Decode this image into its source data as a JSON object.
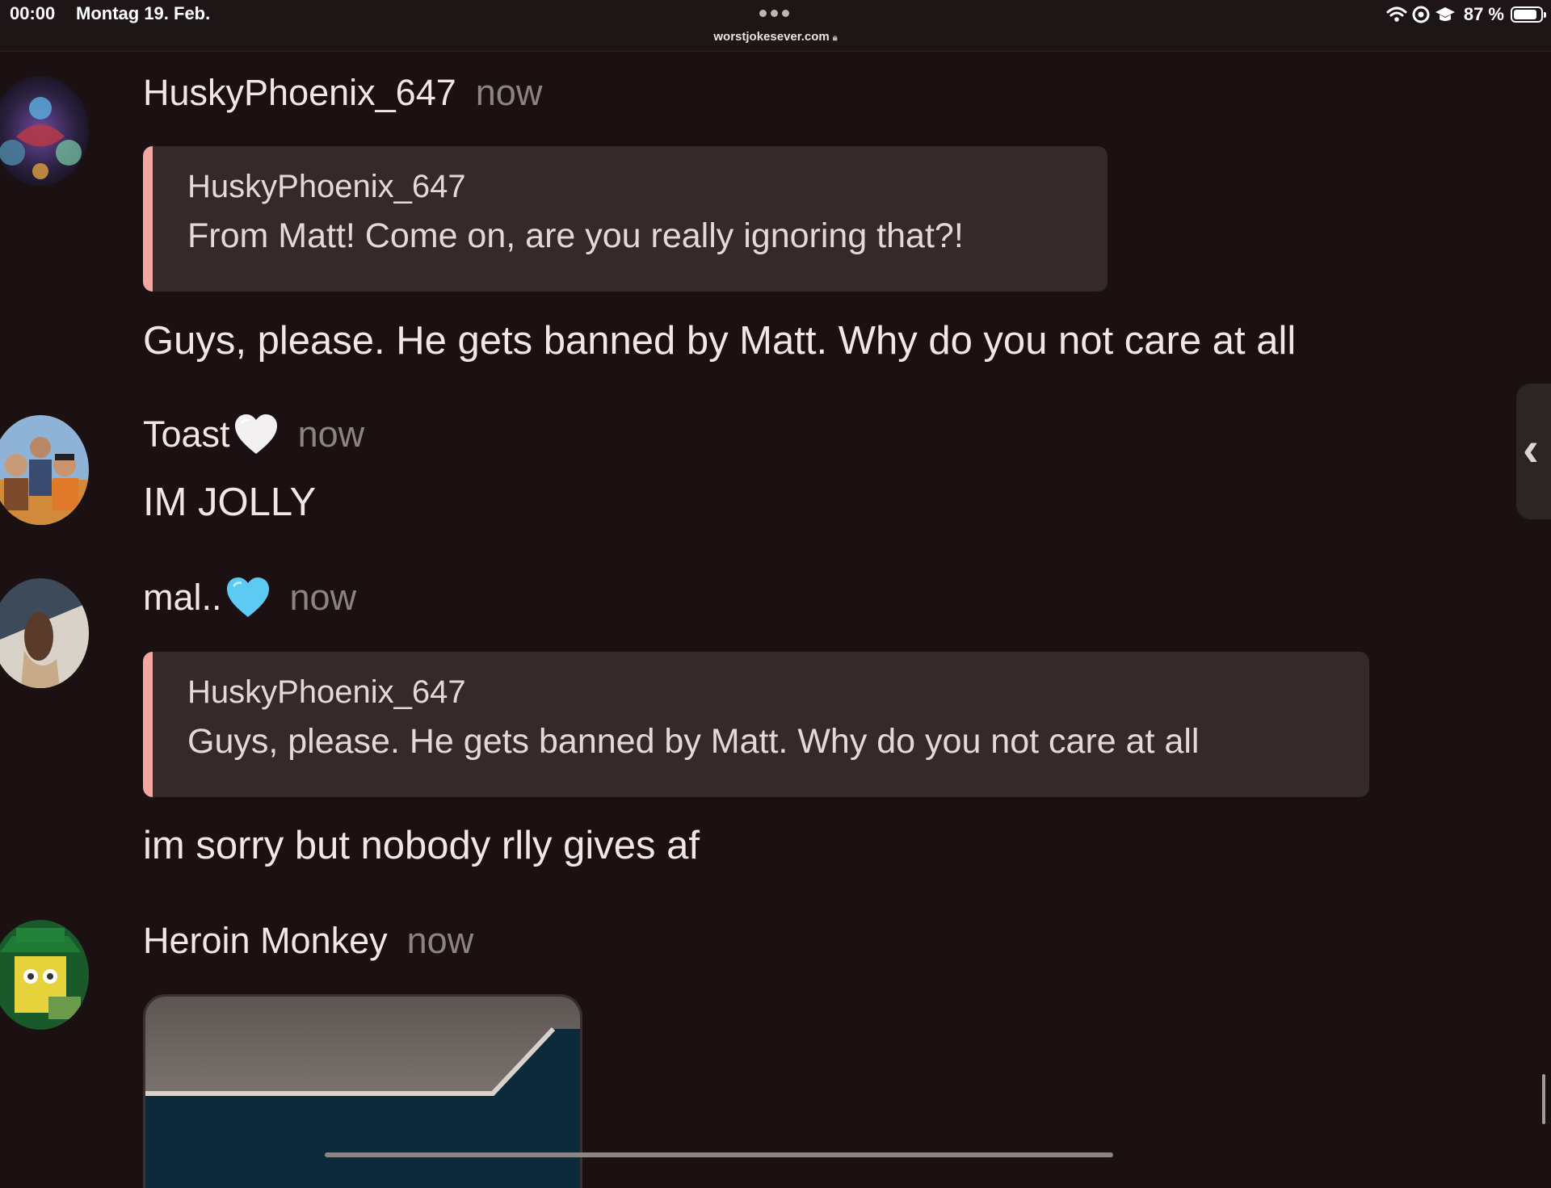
{
  "status_bar": {
    "time": "00:00",
    "date": "Montag 19. Feb.",
    "url": "worstjokesever.com",
    "battery": "87 %",
    "battery_level": 0.87,
    "icons": [
      "wifi-icon",
      "at-sign-icon",
      "graduation-cap-icon",
      "battery-icon",
      "lock-icon"
    ]
  },
  "messages": [
    {
      "username": "HuskyPhoenix_647",
      "time": "now",
      "reply_to": {
        "author": "HuskyPhoenix_647",
        "text": "From Matt! Come on, are you really ignoring that?!"
      },
      "text": "Guys, please. He gets banned by Matt. Why do you not care at all"
    },
    {
      "username": "Toast",
      "emoji": "white-heart",
      "time": "now",
      "text": "IM JOLLY"
    },
    {
      "username": "mal..",
      "emoji": "light-blue-heart",
      "time": "now",
      "reply_to": {
        "author": "HuskyPhoenix_647",
        "text": "Guys, please. He gets banned by Matt. Why do you not care at all"
      },
      "text": "im sorry but nobody rlly gives af"
    },
    {
      "username": "Heroin Monkey",
      "time": "now",
      "attachment": "image"
    }
  ],
  "colors": {
    "background": "#1b1112",
    "quote_background": "#342a2a",
    "quote_accent": "#f2a8a0",
    "timestamp": "#8d8384"
  },
  "side_handle": "chevron-left-icon"
}
